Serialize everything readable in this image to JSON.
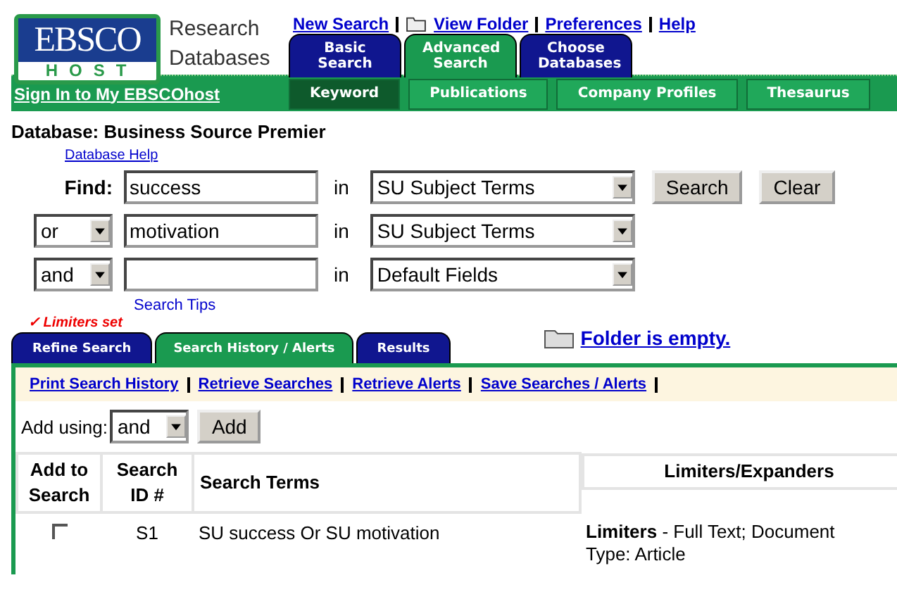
{
  "logo": {
    "top": "EBSCO",
    "bottom": "HOST",
    "caption_lines": [
      "Research",
      "Databases"
    ]
  },
  "top_links": [
    {
      "label": "New Search",
      "icon": false
    },
    {
      "label": "View Folder",
      "icon": true
    },
    {
      "label": "Preferences",
      "icon": false
    },
    {
      "label": "Help",
      "icon": false
    }
  ],
  "main_tabs": [
    {
      "label": "Basic Search",
      "selected": false
    },
    {
      "label": "Advanced Search",
      "selected": true
    },
    {
      "label": "Choose Databases",
      "selected": false
    }
  ],
  "sign_in": "Sign In to My EBSCOhost",
  "sub_tabs": [
    {
      "label": "Keyword",
      "selected": true
    },
    {
      "label": "Publications",
      "selected": false
    },
    {
      "label": "Company Profiles",
      "selected": false
    },
    {
      "label": "Thesaurus",
      "selected": false
    }
  ],
  "database": "Database: Business Source Premier",
  "database_help": "Database Help",
  "find_label": "Find:",
  "rows": [
    {
      "operator": null,
      "value": "success",
      "in_label": "in",
      "field": "SU Subject Terms"
    },
    {
      "operator": "or",
      "value": "motivation",
      "in_label": "in",
      "field": "SU Subject Terms"
    },
    {
      "operator": "and",
      "value": "",
      "in_label": "in",
      "field": "Default Fields"
    }
  ],
  "buttons": [
    "Search",
    "Clear"
  ],
  "search_tips": "Search Tips",
  "limiters_set": "✓ Limiters set",
  "folder_status": "Folder is empty.",
  "lower_tabs": [
    {
      "label": "Refine Search",
      "selected": false
    },
    {
      "label": "Search History / Alerts",
      "selected": true
    },
    {
      "label": "Results",
      "selected": false
    }
  ],
  "history_links": [
    "Print Search History",
    "Retrieve Searches",
    "Retrieve Alerts",
    "Save Searches / Alerts"
  ],
  "add_using": {
    "label": "Add using:",
    "operator": "and",
    "button": "Add"
  },
  "table": {
    "columns": [
      "Add to Search",
      "Search ID #",
      "Search Terms",
      "Limiters/Expanders"
    ],
    "rows": [
      {
        "checked": false,
        "id": "S1",
        "terms": "SU success Or SU motivation",
        "limiters": "**Limiters** - Full Text; Document",
        "limiters_2": "Type: Article"
      }
    ]
  }
}
